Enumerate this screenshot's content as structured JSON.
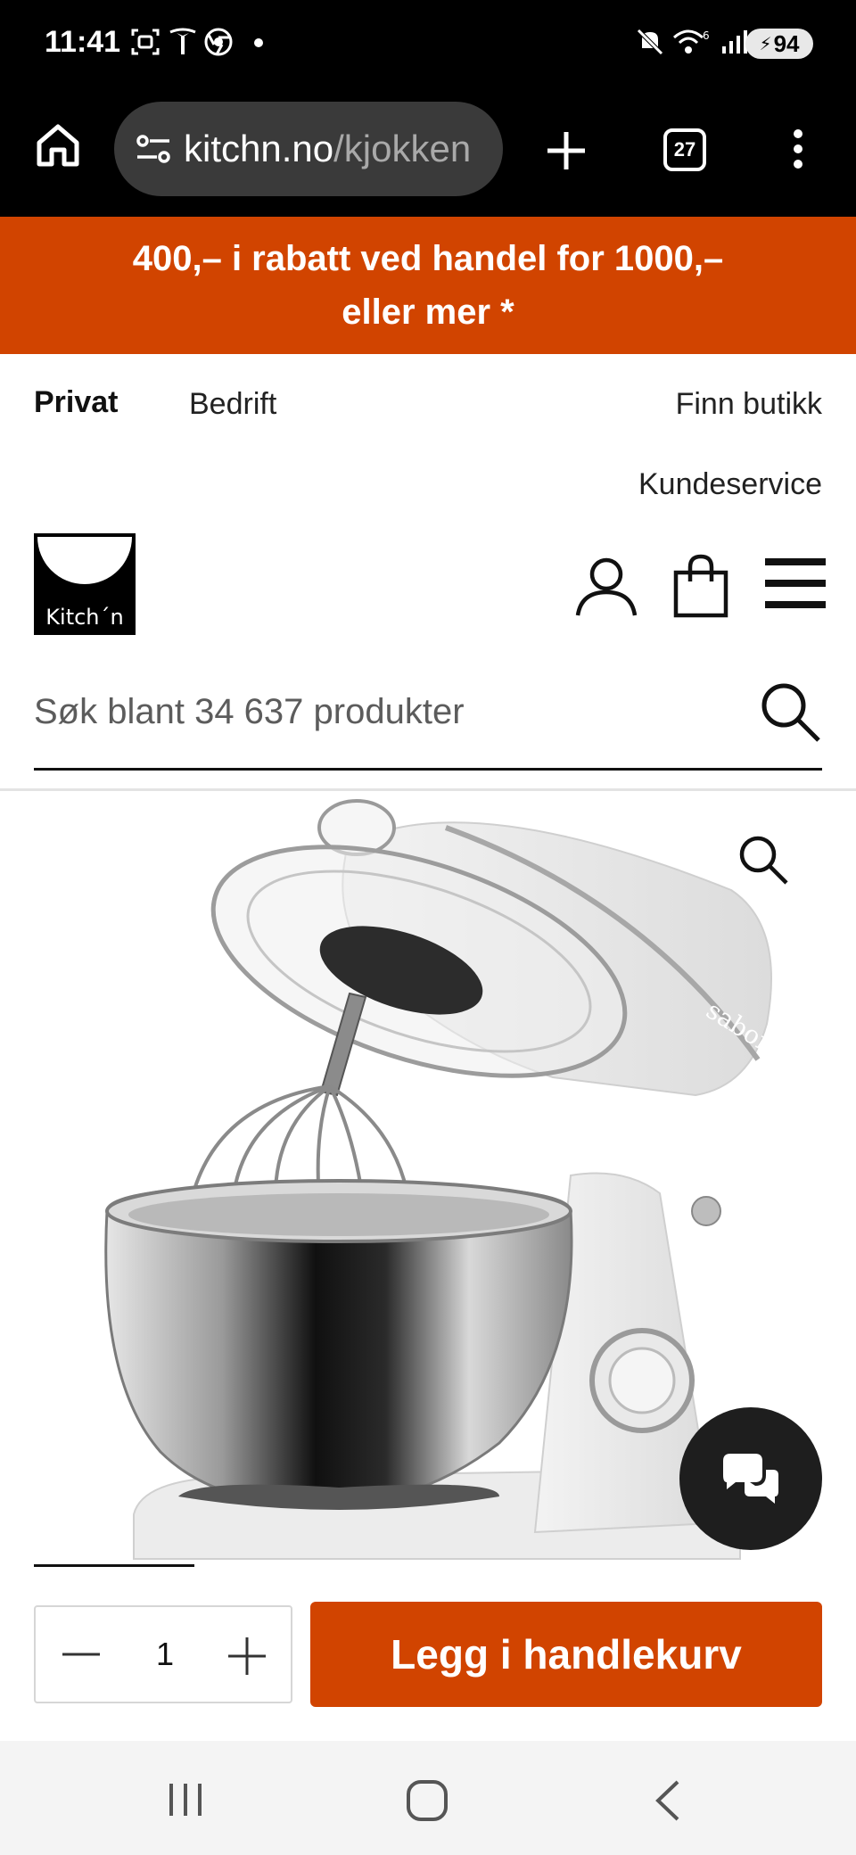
{
  "status_bar": {
    "time": "11:41",
    "battery": "94",
    "icons": [
      "screenshot-icon",
      "tesla-icon",
      "chrome-icon",
      "dot-icon",
      "mute-icon",
      "wifi-icon",
      "signal-icon",
      "battery-icon"
    ]
  },
  "browser": {
    "url_host": "kitchn.no",
    "url_path": "/kjokken",
    "tab_count": "27"
  },
  "promo": {
    "text": "400,– i rabatt ved handel for 1000,– eller mer *"
  },
  "top_nav": {
    "privat": "Privat",
    "bedrift": "Bedrift",
    "finn_butikk": "Finn butikk",
    "kundeservice": "Kundeservice"
  },
  "logo": {
    "text": "Kitch´n"
  },
  "search": {
    "placeholder": "Søk blant 34 637 produkter"
  },
  "product": {
    "brand_mark": "sabor"
  },
  "purchase": {
    "quantity": "1",
    "add_to_cart_label": "Legg i handlekurv"
  },
  "colors": {
    "accent": "#d14400",
    "dark": "#1e1e1e"
  }
}
